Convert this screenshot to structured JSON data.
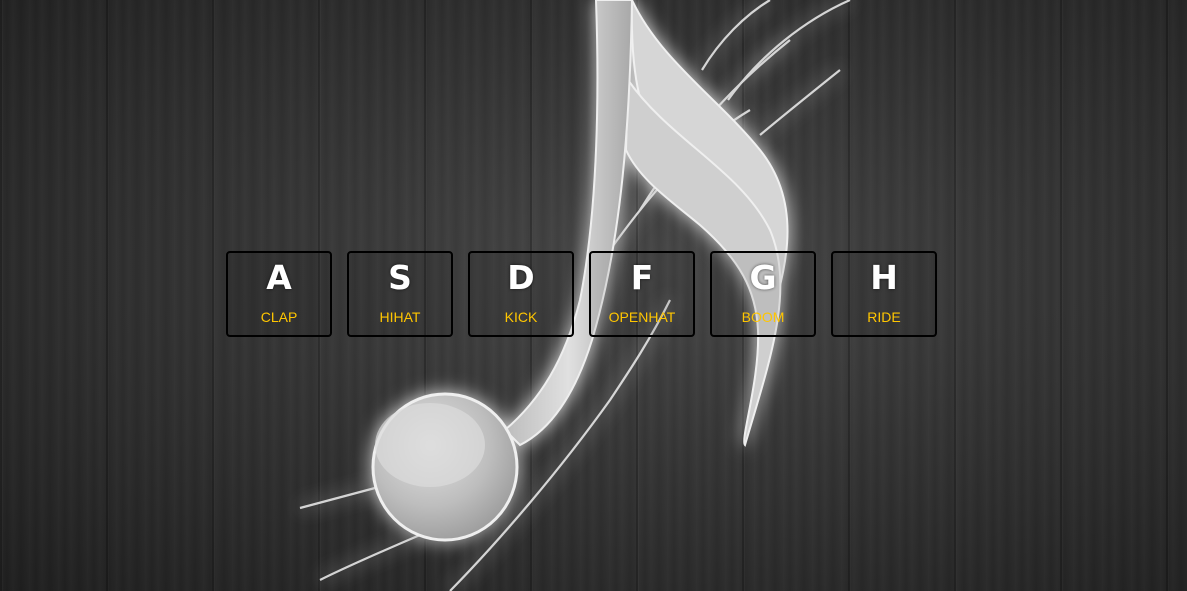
{
  "drum_kit": {
    "keys": [
      {
        "key": "A",
        "sound": "CLAP"
      },
      {
        "key": "S",
        "sound": "HIHAT"
      },
      {
        "key": "D",
        "sound": "KICK"
      },
      {
        "key": "F",
        "sound": "OPENHAT"
      },
      {
        "key": "G",
        "sound": "BOOM"
      },
      {
        "key": "H",
        "sound": "RIDE"
      }
    ]
  },
  "colors": {
    "key_letter": "#ffffff",
    "sound_label": "#ffc600",
    "key_border": "#000000",
    "background": "#2a2a2a"
  },
  "icons": {
    "background_art": "music-note-icon"
  }
}
